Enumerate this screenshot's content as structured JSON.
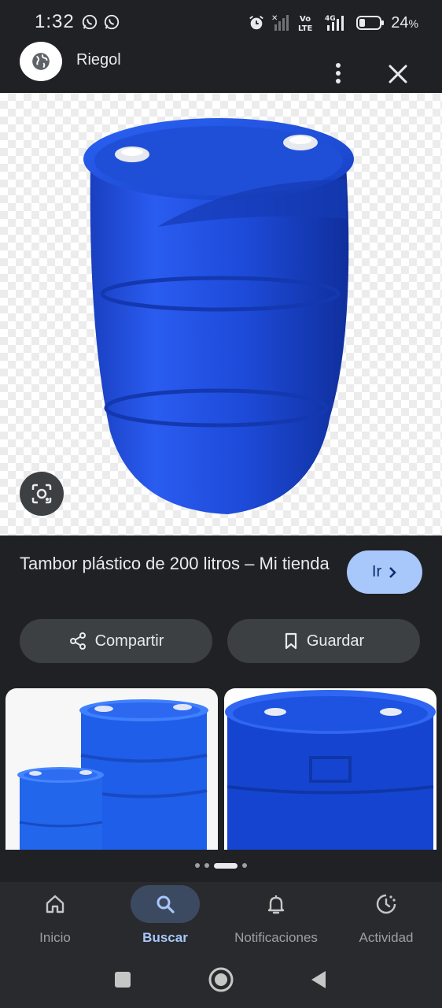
{
  "status_bar": {
    "time": "1:32",
    "battery": "24"
  },
  "header": {
    "site_name": "Riegol"
  },
  "product": {
    "title": "Tambor plástico de 200 litros – Mi tienda",
    "go_label": "Ir"
  },
  "actions": {
    "share_label": "Compartir",
    "save_label": "Guardar"
  },
  "bottom_nav": {
    "items": [
      {
        "label": "Inicio",
        "icon": "home-icon"
      },
      {
        "label": "Buscar",
        "icon": "search-icon"
      },
      {
        "label": "Notificaciones",
        "icon": "bell-icon"
      },
      {
        "label": "Actividad",
        "icon": "activity-icon"
      }
    ],
    "active_index": 1
  },
  "colors": {
    "accent": "#a8c7fa",
    "drum_blue": "#1f4fd6",
    "background": "#202124"
  }
}
